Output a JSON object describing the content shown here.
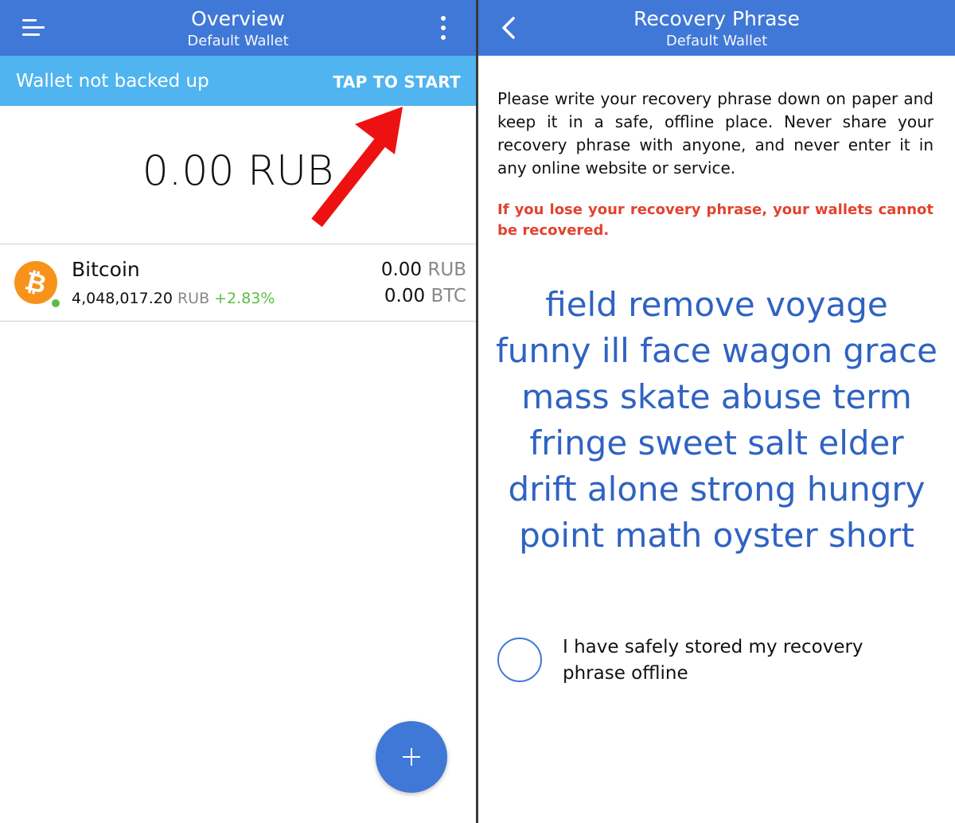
{
  "overview": {
    "title": "Overview",
    "subtitle": "Default Wallet",
    "banner": {
      "message": "Wallet not backed up",
      "action": "TAP TO START"
    },
    "total_balance": "0.00 RUB",
    "assets": [
      {
        "name": "Bitcoin",
        "price": "4,048,017.20",
        "price_currency": "RUB",
        "change": "+2.83%",
        "fiat_balance": "0.00",
        "fiat_unit": "RUB",
        "coin_balance": "0.00",
        "coin_unit": "BTC"
      }
    ],
    "fab_icon": "plus-icon"
  },
  "recovery": {
    "title": "Recovery Phrase",
    "subtitle": "Default Wallet",
    "intro": "Please write your recovery phrase down on paper and keep it in a safe, offline place. Never share your recovery phrase with anyone, and never enter it in any online website or service.",
    "warning": "If you lose your recovery phrase, your wallets cannot be recovered.",
    "phrase_lines": [
      "field remove voyage",
      "funny ill face wagon grace",
      "mass skate abuse term",
      "fringe sweet salt elder",
      "drift alone strong hungry",
      "point math oyster short"
    ],
    "confirm_label": "I have safely stored my recovery phrase offline"
  },
  "colors": {
    "header": "#3f78d6",
    "banner": "#4fb4ef",
    "phrase": "#2f63c2",
    "warning": "#e2432f",
    "positive": "#5fbb45",
    "bitcoin": "#f7931a",
    "annotation_arrow": "#ee1111"
  }
}
